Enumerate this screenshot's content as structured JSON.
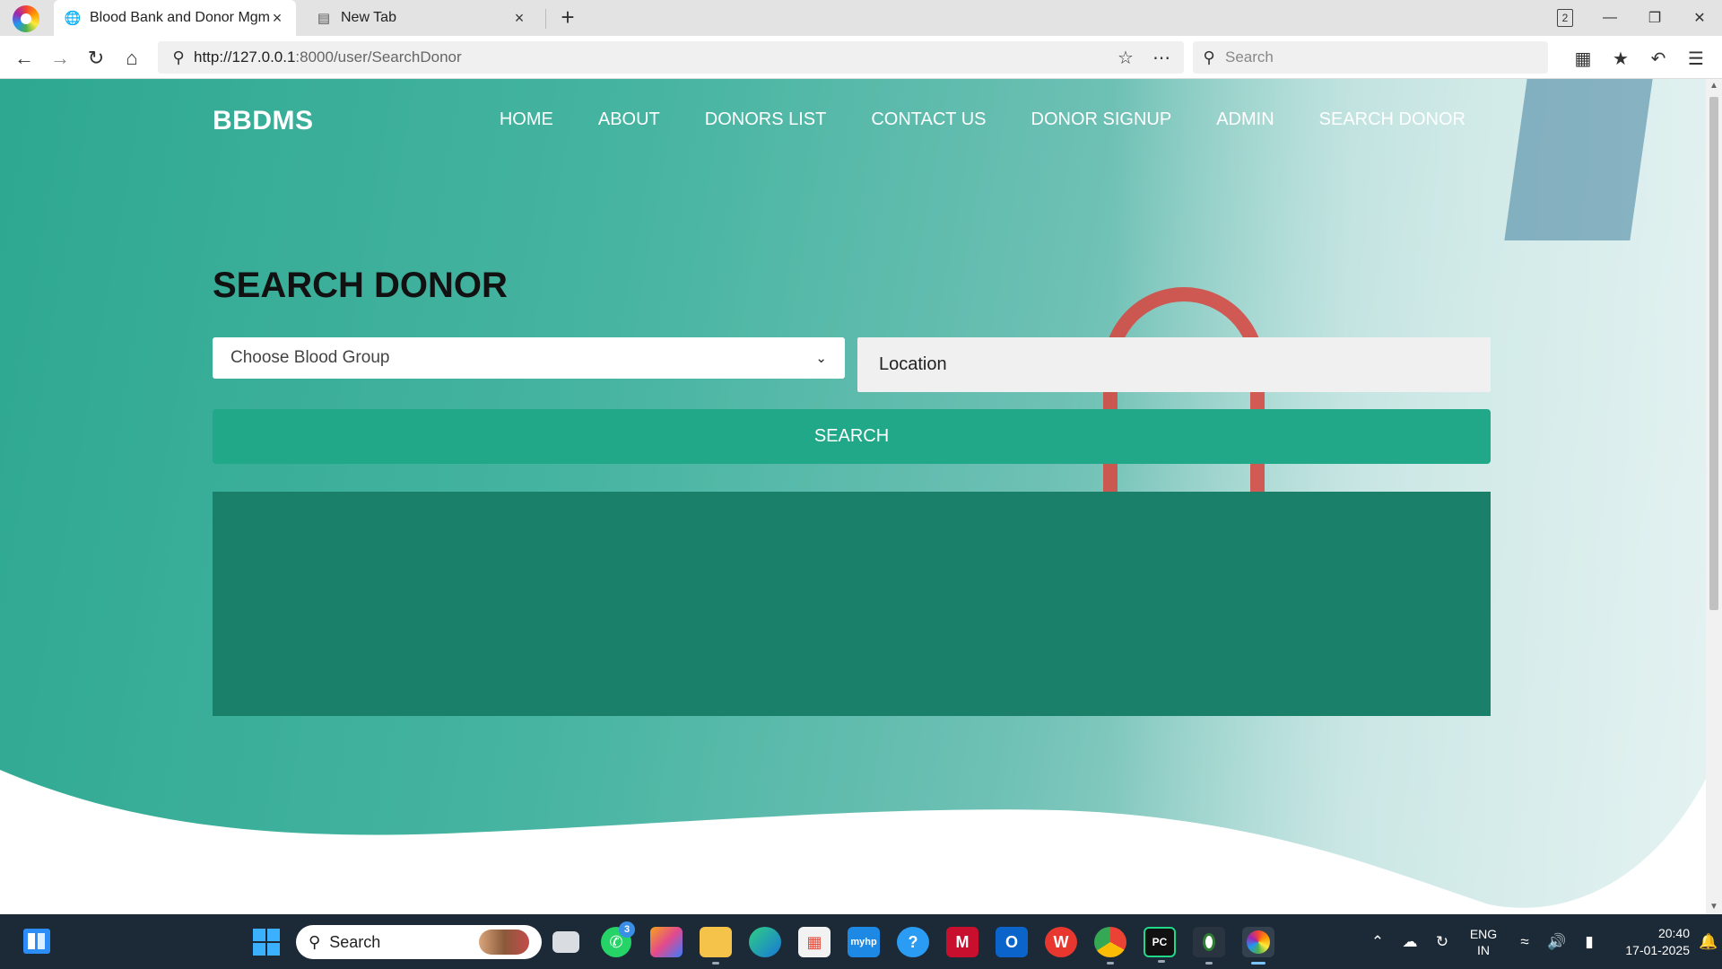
{
  "browser": {
    "tabs": [
      {
        "title": "Blood Bank and Donor Mgmt",
        "active": true
      },
      {
        "title": "New Tab",
        "active": false
      }
    ],
    "tab_count": "2",
    "url_host": "http://127.0.0.1",
    "url_rest": ":8000/user/SearchDonor",
    "search_placeholder": "Search"
  },
  "site": {
    "brand": "BBDMS",
    "nav": [
      "HOME",
      "ABOUT",
      "DONORS LIST",
      "CONTACT US",
      "DONOR SIGNUP",
      "ADMIN",
      "SEARCH DONOR"
    ],
    "heading": "SEARCH DONOR",
    "blood_group_select": "Choose Blood Group",
    "location_placeholder": "Location",
    "search_button": "SEARCH"
  },
  "taskbar": {
    "search_label": "Search",
    "whatsapp_badge": "3",
    "pinned": [
      "file-explorer-window",
      "whatsapp",
      "copilot",
      "file-explorer",
      "edge",
      "microsoft-store",
      "myhp",
      "help",
      "mcafee",
      "outlook",
      "wps-office",
      "chrome",
      "pycharm",
      "node",
      "browser"
    ],
    "language": "ENG",
    "region": "IN",
    "time": "20:40",
    "date": "17-01-2025"
  },
  "colors": {
    "accent": "#20a889",
    "results_panel": "#1a8069",
    "hero_start": "#2ea891",
    "hero_end": "#c6e4e2"
  }
}
